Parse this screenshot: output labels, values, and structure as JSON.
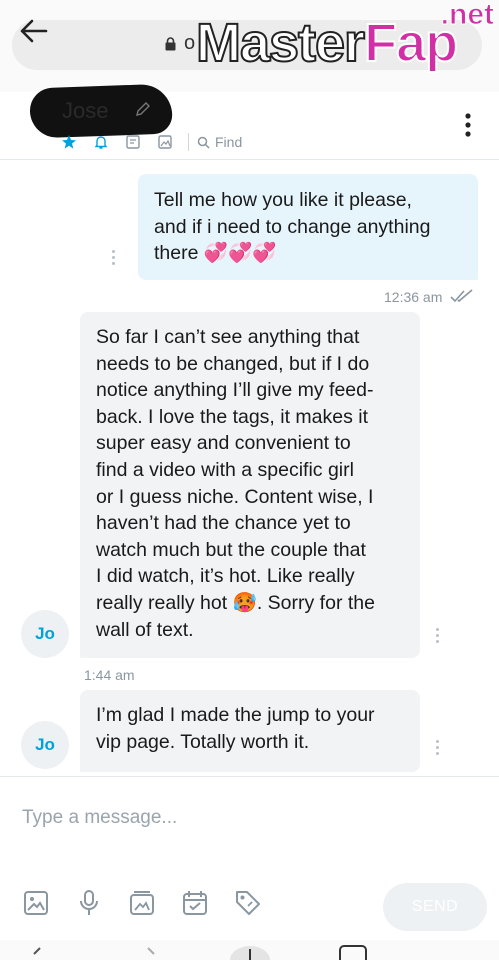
{
  "browser": {
    "url_text": "o",
    "watermark": {
      "main": "Master",
      "accent": "Fap",
      "suffix": ".net"
    }
  },
  "header": {
    "contact_name": "Jose",
    "find_label": "Find",
    "accent_color": "#00a3d9"
  },
  "messages": [
    {
      "direction": "outgoing",
      "lines": [
        "Tell me how you like it please,",
        "and if i need to change anything",
        "there 💞💞💞"
      ],
      "time": "12:36 am",
      "status": "read"
    },
    {
      "direction": "incoming",
      "avatar_initials": "Jo",
      "lines": [
        "So far I can’t see anything that",
        "needs to be changed, but if I do",
        "notice anything I’ll give my feed-",
        "back. I love the tags, it makes it",
        "super easy and convenient to",
        "find a video with a specific girl",
        "or I guess niche. Content wise, I",
        "haven’t had the chance yet to",
        "watch much but the couple that",
        "I did watch, it’s hot. Like really",
        "really really hot 🥵. Sorry for the",
        "wall of text."
      ],
      "time": "1:44 am"
    },
    {
      "direction": "incoming",
      "avatar_initials": "Jo",
      "lines": [
        "I’m glad I made the jump to your",
        "vip page. Totally worth it."
      ]
    }
  ],
  "composer": {
    "placeholder": "Type a message...",
    "send_label": "SEND",
    "tools": [
      "image-icon",
      "microphone-icon",
      "media-vault-icon",
      "schedule-icon",
      "price-tag-icon"
    ]
  }
}
